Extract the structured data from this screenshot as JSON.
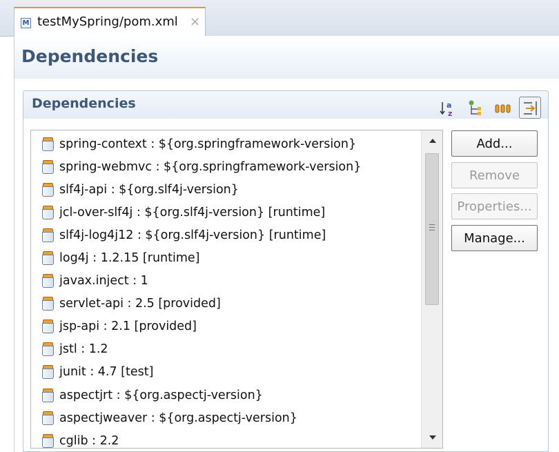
{
  "editor_tab": {
    "icon_letter": "M",
    "label": "testMySpring/pom.xml",
    "close_glyph": "×"
  },
  "page": {
    "title": "Dependencies"
  },
  "section": {
    "title": "Dependencies",
    "toolbar": [
      {
        "name": "sort-alphabetically-icon",
        "active": false
      },
      {
        "name": "show-group-id-icon",
        "active": false
      },
      {
        "name": "show-version-icon",
        "active": false
      },
      {
        "name": "filter-icon",
        "active": true
      }
    ]
  },
  "dependencies": [
    "spring-context : ${org.springframework-version}",
    "spring-webmvc : ${org.springframework-version}",
    "slf4j-api : ${org.slf4j-version}",
    "jcl-over-slf4j : ${org.slf4j-version} [runtime]",
    "slf4j-log4j12 : ${org.slf4j-version} [runtime]",
    "log4j : 1.2.15 [runtime]",
    "javax.inject : 1",
    "servlet-api : 2.5 [provided]",
    "jsp-api : 2.1 [provided]",
    "jstl : 1.2",
    "junit : 4.7 [test]",
    "aspectjrt : ${org.aspectj-version}",
    "aspectjweaver : ${org.aspectj-version}",
    "cglib : 2.2"
  ],
  "buttons": {
    "add": "Add...",
    "remove": "Remove",
    "properties": "Properties...",
    "manage": "Manage..."
  },
  "colors": {
    "accent_tab": "#f38d2a",
    "title_text": "#3e5876"
  }
}
